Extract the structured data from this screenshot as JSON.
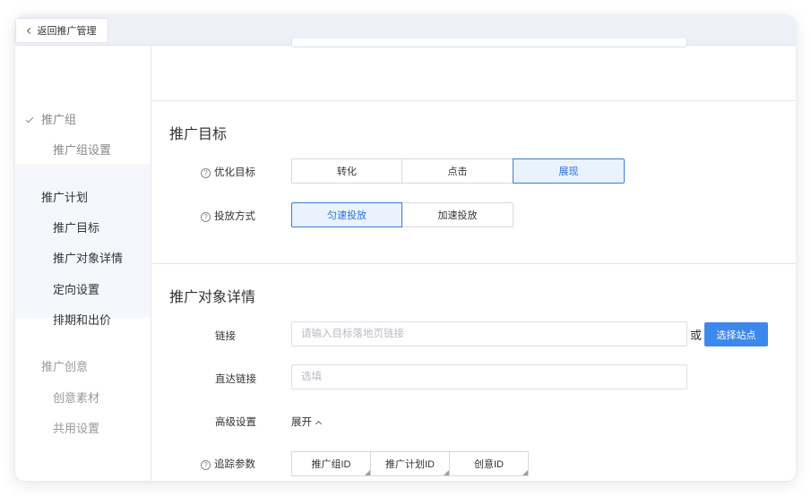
{
  "topbar": {
    "back_label": "返回推广管理"
  },
  "sidebar": {
    "groups": [
      {
        "title": "推广组",
        "checked": true,
        "items": [
          "推广组设置"
        ]
      },
      {
        "title": "推广计划",
        "active": true,
        "items": [
          "推广目标",
          "推广对象详情",
          "定向设置",
          "排期和出价"
        ]
      },
      {
        "title": "推广创意",
        "items": [
          "创意素材",
          "共用设置"
        ]
      }
    ]
  },
  "goal_section": {
    "title": "推广目标",
    "optimize": {
      "label": "优化目标",
      "options": [
        "转化",
        "点击",
        "展现"
      ],
      "selected": "展现"
    },
    "delivery": {
      "label": "投放方式",
      "options": [
        "匀速投放",
        "加速投放"
      ],
      "selected": "匀速投放"
    }
  },
  "detail_section": {
    "title": "推广对象详情",
    "link": {
      "label": "链接",
      "placeholder": "请输入目标落地页链接",
      "or_text": "或",
      "select_button": "选择站点"
    },
    "direct_link": {
      "label": "直达链接",
      "placeholder": "选填"
    },
    "advanced": {
      "label": "高级设置",
      "toggle": "展开"
    },
    "tracking": {
      "label": "追踪参数",
      "tags": [
        "推广组ID",
        "推广计划ID",
        "创意ID"
      ]
    }
  },
  "colors": {
    "accent": "#3d88ec",
    "active_bg": "#eaf2fd",
    "sidebar_active_bg": "#f5f7fd"
  }
}
